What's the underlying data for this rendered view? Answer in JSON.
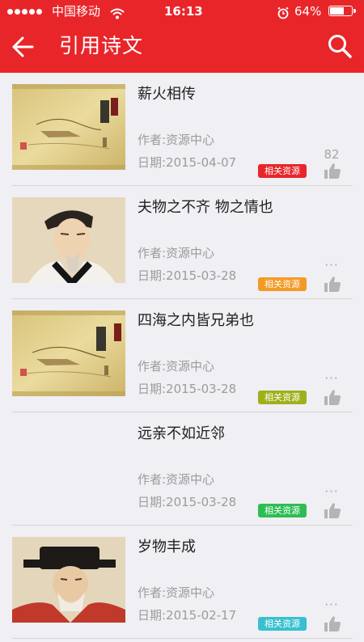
{
  "status_bar": {
    "carrier": "中国移动",
    "time": "16:13",
    "battery": "64%",
    "battery_level": 0.64
  },
  "nav": {
    "title": "引用诗文",
    "back_icon": "arrow-left-icon",
    "search_icon": "search-icon"
  },
  "colors": {
    "header": "#e8262a",
    "badge_red": "#e8262a",
    "badge_orange": "#f39a26",
    "badge_olive": "#9fb01b",
    "badge_green": "#2ebd54",
    "badge_cyan": "#39c0d0"
  },
  "items": [
    {
      "title": "薪火相传",
      "author": "作者:资源中心",
      "date": "日期:2015-04-07",
      "badge": "相关资源",
      "likes": "82",
      "thumb": "zhuangzi-book-cover"
    },
    {
      "title": "夫物之不齐 物之情也",
      "author": "作者:资源中心",
      "date": "日期:2015-03-28",
      "badge": "相关资源",
      "likes": "···",
      "thumb": "scholar-portrait"
    },
    {
      "title": "四海之内皆兄弟也",
      "author": "作者:资源中心",
      "date": "日期:2015-03-28",
      "badge": "相关资源",
      "likes": "···",
      "thumb": "lunyu-book-cover"
    },
    {
      "title": "远亲不如近邻",
      "author": "作者:资源中心",
      "date": "日期:2015-03-28",
      "badge": "相关资源",
      "likes": "···",
      "thumb": ""
    },
    {
      "title": "岁物丰成",
      "author": "作者:资源中心",
      "date": "日期:2015-02-17",
      "badge": "相关资源",
      "likes": "···",
      "thumb": "official-portrait"
    }
  ]
}
